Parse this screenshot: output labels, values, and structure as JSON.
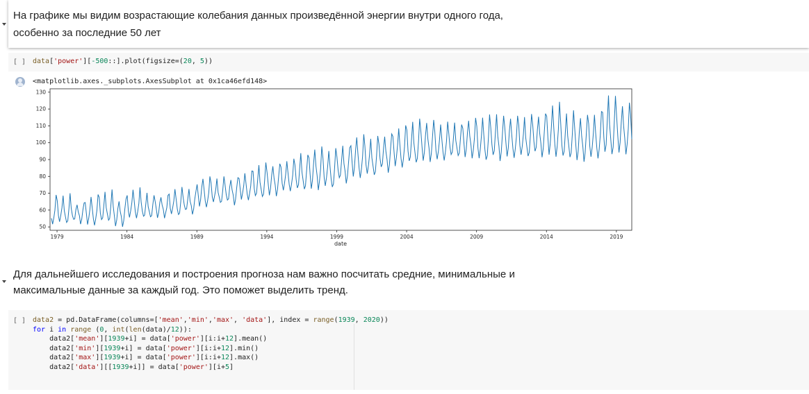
{
  "cells": {
    "md1": {
      "line1": "На графике мы видим возрастающие колебания данных произведённой энергии внутри одного года,",
      "line2": "особенно за последние 50 лет"
    },
    "code1": {
      "run_label": "[ ]",
      "code": "data['power'][-500::].plot(figsize=(20, 5))"
    },
    "output1": {
      "text": "<matplotlib.axes._subplots.AxesSubplot at 0x1ca46efd148>"
    },
    "md2": {
      "line1": "Для дальнейшего исследования и построения прогноза нам важно посчитать средние, минимальные и",
      "line2": "максимальные данные за каждый год. Это поможет выделить тренд."
    },
    "code2": {
      "run_label": "[ ]",
      "lines": [
        "data2 = pd.DataFrame(columns=['mean','min','max', 'data'], index = range(1939, 2020))",
        "for i in range (0, int(len(data)/12)):",
        "    data2['mean'][1939+i] = data['power'][i:i+12].mean()",
        "    data2['min'][1939+i] = data['power'][i:i+12].min()",
        "    data2['max'][1939+i] = data['power'][i:i+12].max()",
        "    data2['data'][[1939+i]] = data['power'][i+5]"
      ]
    }
  },
  "chart_data": {
    "type": "line",
    "title": "",
    "xlabel": "date",
    "ylabel": "",
    "xlim": [
      1978.5,
      2020.1
    ],
    "ylim": [
      48,
      132
    ],
    "x_ticks": [
      "1979",
      "1984",
      "1989",
      "1994",
      "1999",
      "2004",
      "2009",
      "2014",
      "2019"
    ],
    "x_tick_values": [
      1979,
      1984,
      1989,
      1994,
      1999,
      2004,
      2009,
      2014,
      2019
    ],
    "y_ticks": [
      50,
      60,
      70,
      80,
      90,
      100,
      110,
      120,
      130
    ],
    "grid": false,
    "line_color": "#1f77b4",
    "series": [
      {
        "frequency": "monthly",
        "start_year": 1978.6,
        "count": 500,
        "yearly_values": [
          {
            "year": 1979,
            "min": 51,
            "max": 69
          },
          {
            "year": 1980,
            "min": 52,
            "max": 65
          },
          {
            "year": 1981,
            "min": 50,
            "max": 69
          },
          {
            "year": 1982,
            "min": 52,
            "max": 71
          },
          {
            "year": 1983,
            "min": 50,
            "max": 67
          },
          {
            "year": 1984,
            "min": 54,
            "max": 73
          },
          {
            "year": 1985,
            "min": 54,
            "max": 70
          },
          {
            "year": 1986,
            "min": 55,
            "max": 69
          },
          {
            "year": 1987,
            "min": 56,
            "max": 73
          },
          {
            "year": 1988,
            "min": 58,
            "max": 72
          },
          {
            "year": 1989,
            "min": 61,
            "max": 80
          },
          {
            "year": 1990,
            "min": 63,
            "max": 79
          },
          {
            "year": 1991,
            "min": 63,
            "max": 80
          },
          {
            "year": 1992,
            "min": 65,
            "max": 83
          },
          {
            "year": 1993,
            "min": 66,
            "max": 87
          },
          {
            "year": 1994,
            "min": 68,
            "max": 88
          },
          {
            "year": 1995,
            "min": 70,
            "max": 90
          },
          {
            "year": 1996,
            "min": 70,
            "max": 94
          },
          {
            "year": 1997,
            "min": 71,
            "max": 98
          },
          {
            "year": 1998,
            "min": 72,
            "max": 96
          },
          {
            "year": 1999,
            "min": 76,
            "max": 98
          },
          {
            "year": 2000,
            "min": 78,
            "max": 105
          },
          {
            "year": 2001,
            "min": 79,
            "max": 103
          },
          {
            "year": 2002,
            "min": 82,
            "max": 106
          },
          {
            "year": 2003,
            "min": 84,
            "max": 110
          },
          {
            "year": 2004,
            "min": 86,
            "max": 113
          },
          {
            "year": 2005,
            "min": 88,
            "max": 114
          },
          {
            "year": 2006,
            "min": 88,
            "max": 112
          },
          {
            "year": 2007,
            "min": 90,
            "max": 112
          },
          {
            "year": 2008,
            "min": 90,
            "max": 115
          },
          {
            "year": 2009,
            "min": 88,
            "max": 116
          },
          {
            "year": 2010,
            "min": 89,
            "max": 117
          },
          {
            "year": 2011,
            "min": 90,
            "max": 116
          },
          {
            "year": 2012,
            "min": 90,
            "max": 116
          },
          {
            "year": 2013,
            "min": 91,
            "max": 118
          },
          {
            "year": 2014,
            "min": 90,
            "max": 124
          },
          {
            "year": 2015,
            "min": 89,
            "max": 118
          },
          {
            "year": 2016,
            "min": 88,
            "max": 117
          },
          {
            "year": 2017,
            "min": 89,
            "max": 118
          },
          {
            "year": 2018,
            "min": 90,
            "max": 129
          },
          {
            "year": 2019,
            "min": 92,
            "max": 124
          }
        ]
      }
    ]
  }
}
